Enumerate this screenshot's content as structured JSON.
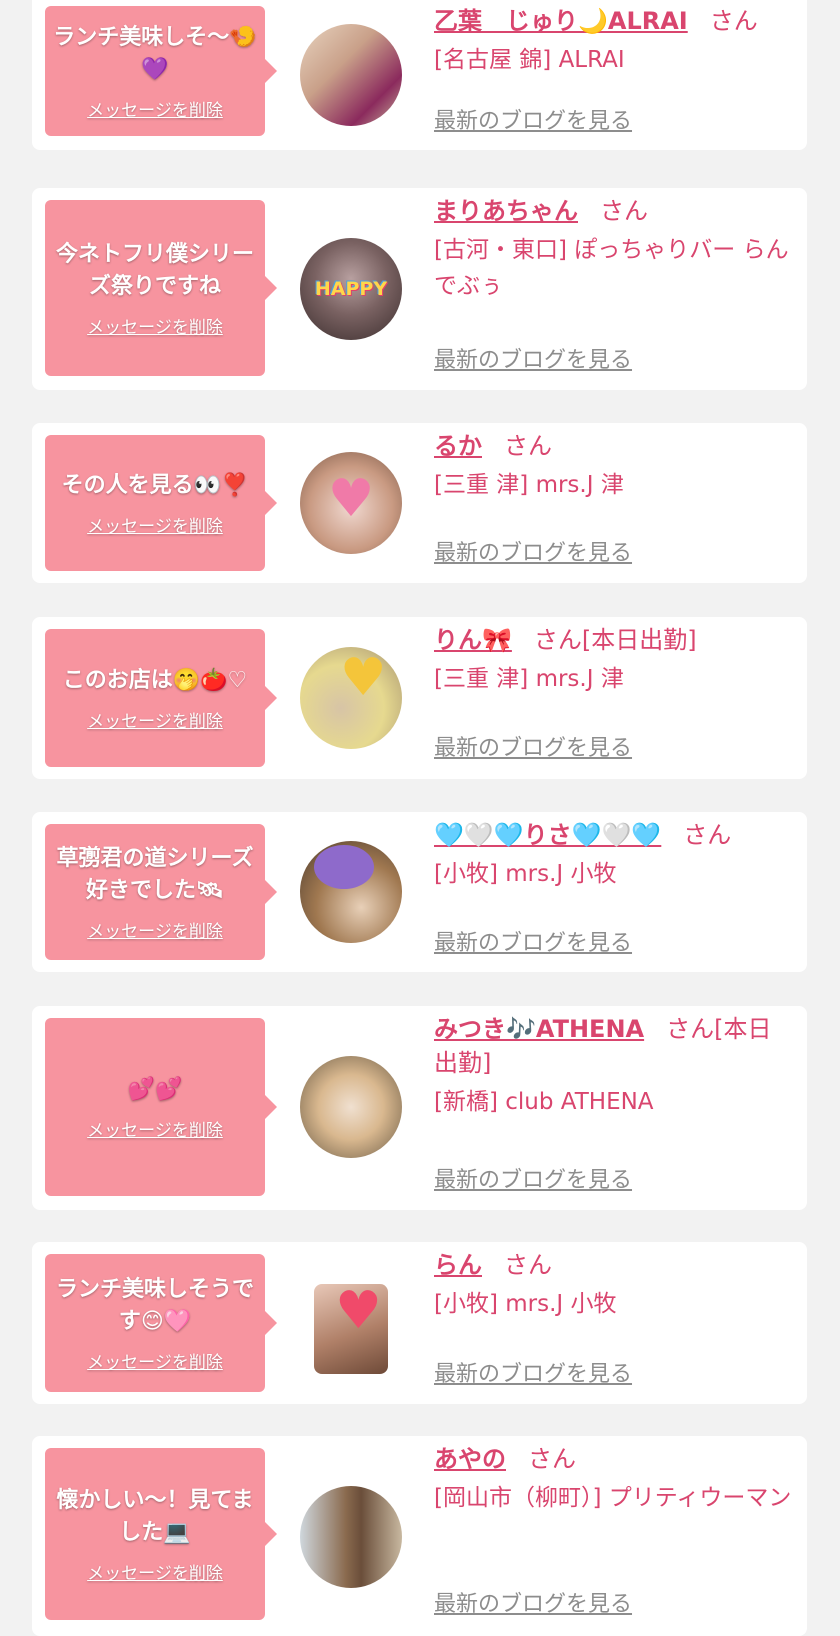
{
  "cards": [
    {
      "message": "ランチ美味しそ〜🍤💜",
      "delete_label": "メッセージを削除",
      "name": "乙葉　じゅり🌙ALRAI",
      "san": "さん",
      "shop": "[名古屋 錦] ALRAI",
      "blog_label": "最新のブログを見る",
      "avatar_colors": [
        "#c9a089",
        "#8b2a5d"
      ]
    },
    {
      "message": "今ネトフリ僕シリーズ祭りですね",
      "delete_label": "メッセージを削除",
      "name": "まりあちゃん",
      "san": "さん",
      "shop": "[古河・東口] ぽっちゃりバー らんでぶぅ",
      "blog_label": "最新のブログを見る",
      "avatar_sticker": "HAPPY",
      "avatar_colors": [
        "#5c4a4a",
        "#b8a0a0"
      ]
    },
    {
      "message": "その人を見る👀❣️",
      "delete_label": "メッセージを削除",
      "name": "るか",
      "san": "さん",
      "shop": "[三重 津] mrs.J 津",
      "blog_label": "最新のブログを見る",
      "avatar_colors": [
        "#c99a82",
        "#f0d8d0"
      ]
    },
    {
      "message": "このお店は🤭🍅♡",
      "delete_label": "メッセージを削除",
      "name": "りん🎀",
      "san": "さん[本日出勤]",
      "shop": "[三重 津] mrs.J 津",
      "blog_label": "最新のブログを見る",
      "avatar_colors": [
        "#e6d98f",
        "#d7c4a6"
      ]
    },
    {
      "message": "草彅君の道シリーズ好きでした🛰",
      "delete_label": "メッセージを削除",
      "name": "🩵🤍🩵りさ🩵🤍🩵",
      "san": "さん",
      "shop": "[小牧] mrs.J 小牧",
      "blog_label": "最新のブログを見る",
      "avatar_colors": [
        "#7a5a3e",
        "#8e6acb"
      ]
    },
    {
      "message": "💕💕",
      "delete_label": "メッセージを削除",
      "name": "みつき🎶ATHENA",
      "san": "さん[本日出勤]",
      "shop": "[新橋] club ATHENA",
      "blog_label": "最新のブログを見る",
      "avatar_colors": [
        "#d9b88f",
        "#f0e0d0"
      ]
    },
    {
      "message": "ランチ美味しそうです😊🩷",
      "delete_label": "メッセージを削除",
      "name": "らん",
      "san": "さん",
      "shop": "[小牧] mrs.J 小牧",
      "blog_label": "最新のブログを見る",
      "avatar_colors": [
        "#b08068",
        "#e8c8b8"
      ]
    },
    {
      "message": "懐かしい〜！見てました💻",
      "delete_label": "メッセージを削除",
      "name": "あやの",
      "san": "さん",
      "shop": "[岡山市（柳町）] プリティウーマン",
      "blog_label": "最新のブログを見る",
      "avatar_colors": [
        "#8a6a4e",
        "#cfd7dd"
      ]
    }
  ]
}
